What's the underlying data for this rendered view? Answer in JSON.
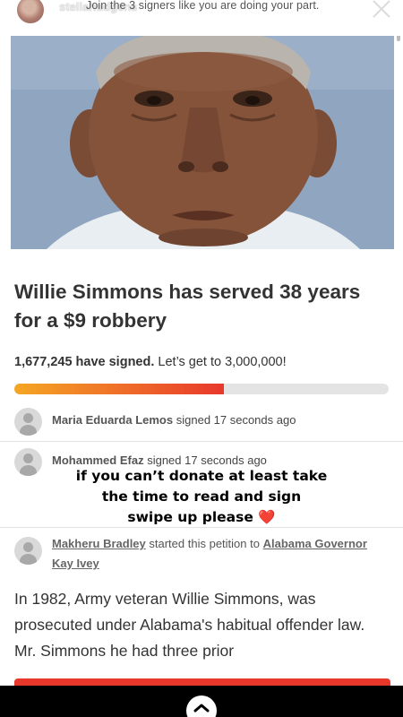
{
  "story": {
    "username": "stellahudgens",
    "overlay_text": "Join the 3 signers like you are doing your part."
  },
  "petition": {
    "title": "Willie Simmons has served 38 years for a $9 robbery",
    "signed_count": "1,677,245 have signed.",
    "goal_text": "Let’s get to 3,000,000!",
    "progress_fraction": 0.56
  },
  "signers": [
    {
      "name": "Maria Eduarda Lemos",
      "action": "signed 17 seconds ago"
    },
    {
      "name": "Mohammed Efaz",
      "action": "signed 17 seconds ago"
    }
  ],
  "starter": {
    "name": "Makheru Bradley",
    "action": "started this petition to",
    "target": "Alabama Governor Kay Ivey"
  },
  "body_text": "In 1982, Army veteran Willie Simmons, was prosecuted under Alabama's habitual offender law. Mr. Simmons he had three prior",
  "caption": {
    "line1": "if you can’t donate at least take",
    "line2": "the time to read and sign",
    "line3": "swipe up please",
    "heart": "❤️"
  },
  "colors": {
    "accent_red": "#e8382c",
    "progress_orange": "#f5a623",
    "track_gray": "#e4e4e4"
  }
}
